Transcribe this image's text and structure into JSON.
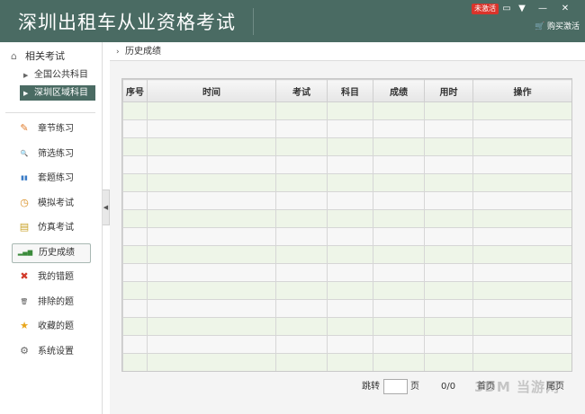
{
  "app": {
    "title": "深圳出租车从业资格考试"
  },
  "titlebar": {
    "unactivated_badge": "未激活",
    "icons": [
      "message-icon",
      "dropdown-menu-icon",
      "minimize-icon",
      "close-icon"
    ],
    "icon_glyphs": [
      "▭",
      "▼",
      "—",
      "✕"
    ],
    "buy_activate_label": "购买激活",
    "cart_glyph": "🛒"
  },
  "sidebar": {
    "tree_title": "相关考试",
    "tree_items": [
      {
        "label": "全国公共科目",
        "active": false
      },
      {
        "label": "深圳区域科目",
        "active": true
      }
    ],
    "menu": [
      {
        "label": "章节练习",
        "icon": "pencil-icon",
        "glyph": "✎",
        "color": "#e07b2a"
      },
      {
        "label": "筛选练习",
        "icon": "magnifier-icon",
        "glyph": "🔍",
        "color": "#4a78b5"
      },
      {
        "label": "套题练习",
        "icon": "books-icon",
        "glyph": "▮▮",
        "color": "#3a7cc7"
      },
      {
        "label": "模拟考试",
        "icon": "clock-icon",
        "glyph": "◷",
        "color": "#d88c1e"
      },
      {
        "label": "仿真考试",
        "icon": "notepad-icon",
        "glyph": "▤",
        "color": "#c9a227"
      },
      {
        "label": "历史成绩",
        "icon": "bar-chart-icon",
        "glyph": "▂▄▆",
        "color": "#3b8b3b",
        "active": true
      },
      {
        "label": "我的错题",
        "icon": "red-x-icon",
        "glyph": "✖",
        "color": "#d23a2a"
      },
      {
        "label": "排除的题",
        "icon": "trash-icon",
        "glyph": "🗑",
        "color": "#555555"
      },
      {
        "label": "收藏的题",
        "icon": "star-icon",
        "glyph": "★",
        "color": "#e8a51a"
      },
      {
        "label": "系统设置",
        "icon": "gear-icon",
        "glyph": "⚙",
        "color": "#666666"
      }
    ]
  },
  "main": {
    "breadcrumb": "历史成绩",
    "table": {
      "columns": [
        "序号",
        "时间",
        "考试",
        "科目",
        "成绩",
        "用时",
        "操作"
      ],
      "row_count": 15
    },
    "pager": {
      "jump_label": "跳转",
      "page_unit": "页",
      "page_count": "0/0",
      "first_label": "首页",
      "last_label": "尾页"
    }
  },
  "watermark": "3DM 当游网"
}
